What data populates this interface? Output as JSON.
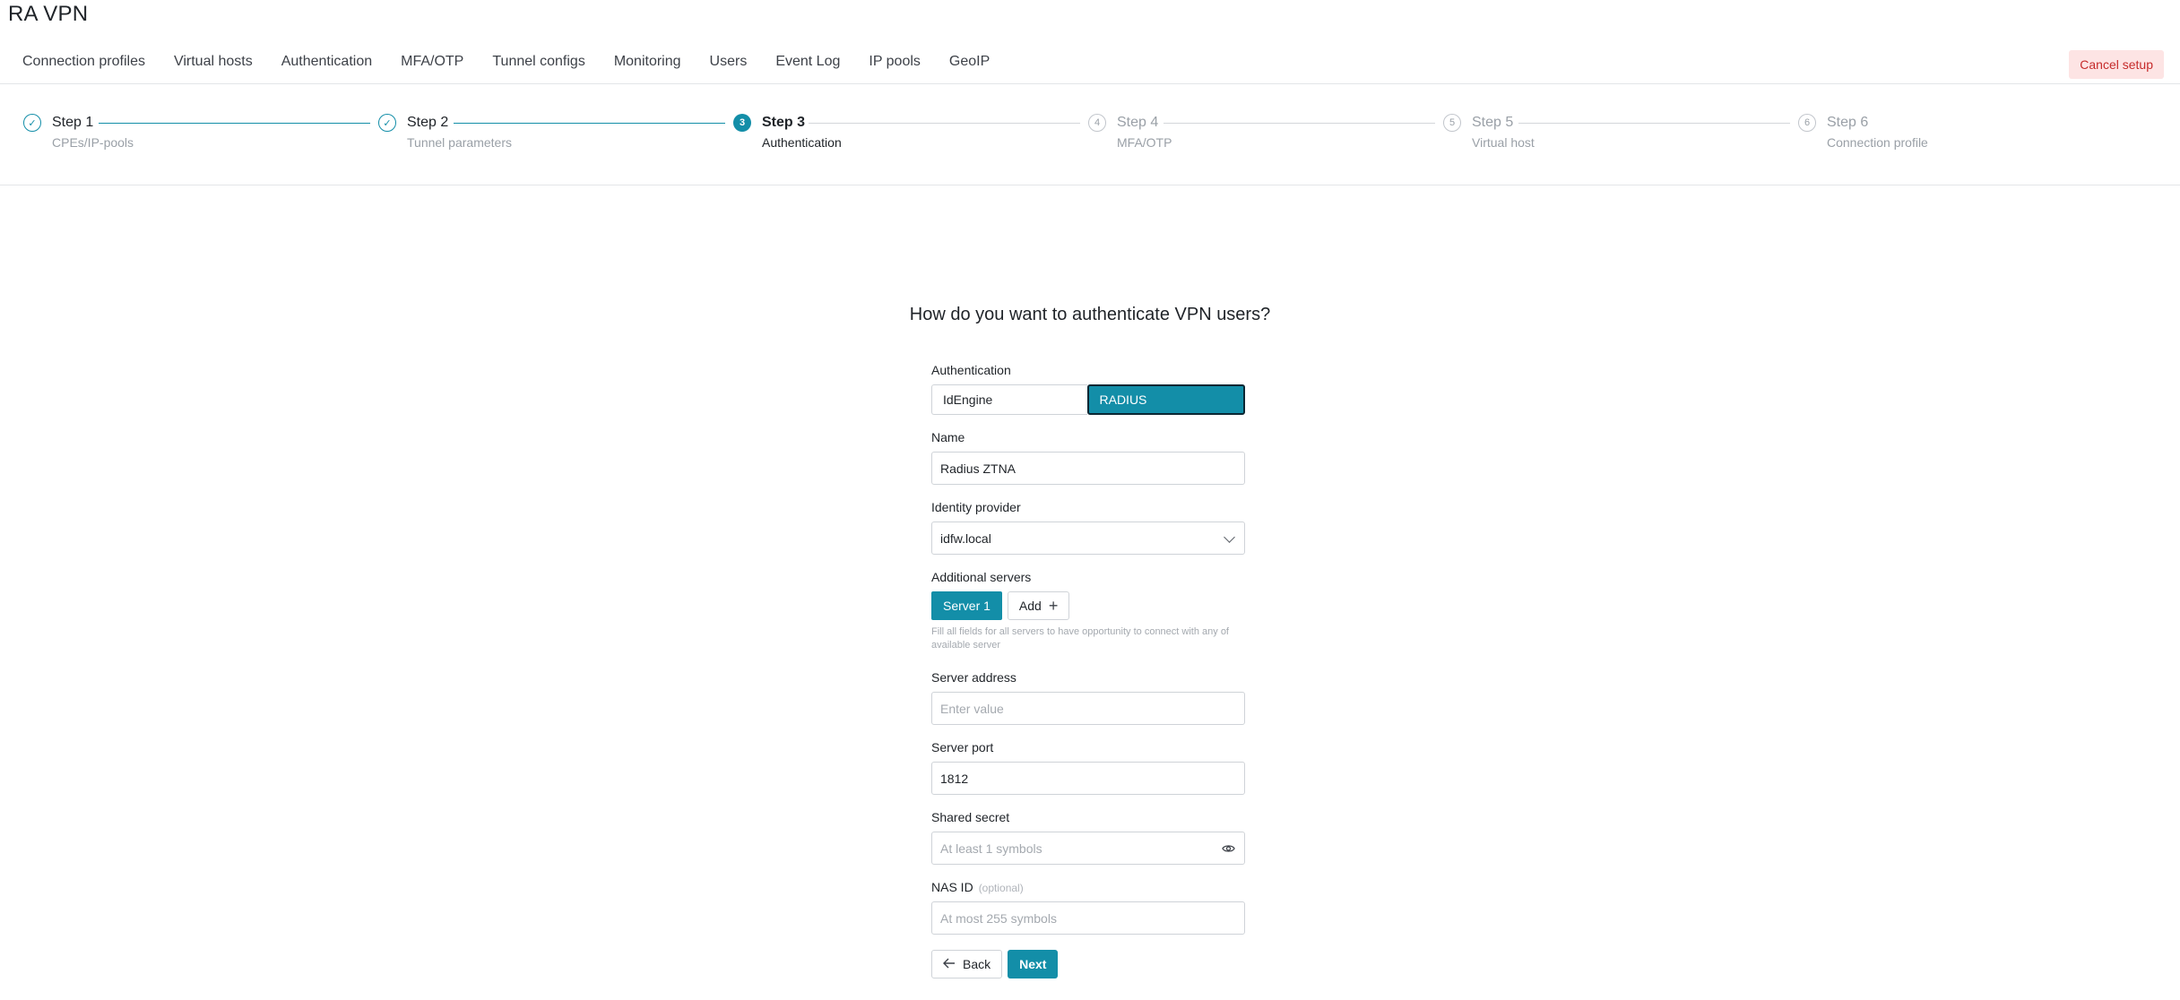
{
  "app": {
    "title": "RA VPN"
  },
  "nav": {
    "tabs": [
      {
        "label": "Connection profiles"
      },
      {
        "label": "Virtual hosts"
      },
      {
        "label": "Authentication"
      },
      {
        "label": "MFA/OTP"
      },
      {
        "label": "Tunnel configs"
      },
      {
        "label": "Monitoring"
      },
      {
        "label": "Users"
      },
      {
        "label": "Event Log"
      },
      {
        "label": "IP pools"
      },
      {
        "label": "GeoIP"
      }
    ],
    "cancel_label": "Cancel setup"
  },
  "stepper": {
    "steps": [
      {
        "marker": "✓",
        "title": "Step 1",
        "subtitle": "CPEs/IP-pools",
        "state": "done"
      },
      {
        "marker": "✓",
        "title": "Step 2",
        "subtitle": "Tunnel parameters",
        "state": "done"
      },
      {
        "marker": "3",
        "title": "Step 3",
        "subtitle": "Authentication",
        "state": "active"
      },
      {
        "marker": "4",
        "title": "Step 4",
        "subtitle": "MFA/OTP",
        "state": "pending"
      },
      {
        "marker": "5",
        "title": "Step 5",
        "subtitle": "Virtual host",
        "state": "pending"
      },
      {
        "marker": "6",
        "title": "Step 6",
        "subtitle": "Connection profile",
        "state": "pending"
      }
    ]
  },
  "form": {
    "question": "How do you want to authenticate VPN users?",
    "authentication": {
      "label": "Authentication",
      "options": [
        "IdEngine",
        "RADIUS"
      ],
      "selected": "RADIUS"
    },
    "name": {
      "label": "Name",
      "value": "Radius ZTNA"
    },
    "identity_provider": {
      "label": "Identity provider",
      "value": "idfw.local"
    },
    "additional_servers": {
      "label": "Additional servers",
      "tabs": [
        "Server 1"
      ],
      "add_label": "Add",
      "hint": "Fill all fields for all servers to have opportunity to connect with any of available server"
    },
    "server_address": {
      "label": "Server address",
      "value": "",
      "placeholder": "Enter value"
    },
    "server_port": {
      "label": "Server port",
      "value": "1812"
    },
    "shared_secret": {
      "label": "Shared secret",
      "value": "",
      "placeholder": "At least 1 symbols"
    },
    "nas_id": {
      "label": "NAS ID",
      "optional": "(optional)",
      "value": "",
      "placeholder": "At most 255 symbols"
    },
    "back_label": "Back",
    "next_label": "Next"
  },
  "colors": {
    "accent": "#138ea8",
    "danger_bg": "#fde4e4",
    "danger_text": "#c62b2b"
  }
}
